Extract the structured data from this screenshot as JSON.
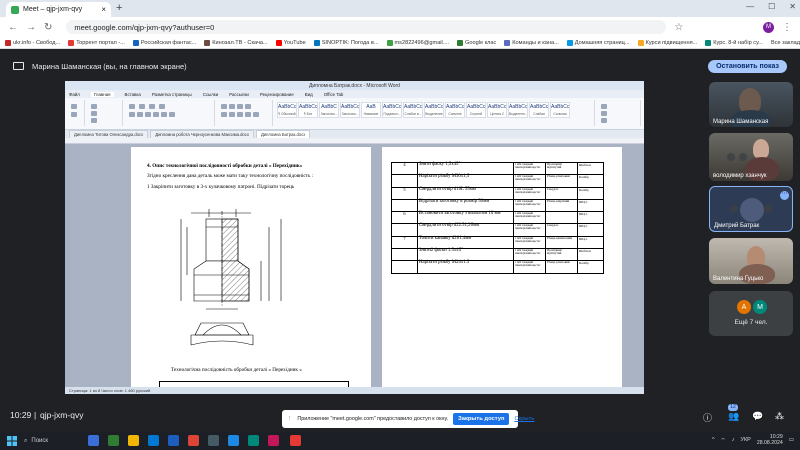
{
  "browser": {
    "tab_title": "Meet – qjp-jxm-qvy",
    "new_tab": "+",
    "url": "meet.google.com/qjp-jxm-qvy?authuser=0",
    "profile_initial": "M",
    "bookmarks": [
      {
        "label": "ukr.info - Свобод...",
        "color": "#c62828"
      },
      {
        "label": "Торрент портал -...",
        "color": "#e53935"
      },
      {
        "label": "Российская фантас...",
        "color": "#1565c0"
      },
      {
        "label": "Кинозал.ТВ - Скача...",
        "color": "#6d4c41"
      },
      {
        "label": "YouTube",
        "color": "#ff0000"
      },
      {
        "label": "SINOPTIK: Погода в...",
        "color": "#0277bd"
      },
      {
        "label": "ms2822496@gmail....",
        "color": "#43a047"
      },
      {
        "label": "Google клас",
        "color": "#2e7d32"
      },
      {
        "label": "Команды и кана...",
        "color": "#5c6bc0"
      },
      {
        "label": "Домашняя страниц...",
        "color": "#039be5"
      },
      {
        "label": "Курси підвищення...",
        "color": "#f9a825"
      },
      {
        "label": "Курс. 8-й набір су...",
        "color": "#00897b"
      }
    ],
    "all_bookmarks": "Все закладки"
  },
  "meet": {
    "presenter_text": "Марина Шаманская (вы, на главном экране)",
    "stop_button": "Остановить показ",
    "time": "10:29",
    "separator": "|",
    "meeting_code": "qjp-jxm-qvy",
    "badge_count": "12",
    "notification_text": "Приложение \"meet.google.com\" предоставило доступ к окну.",
    "notification_close": "Закрыть доступ",
    "notification_hide": "Скрыть",
    "participants": [
      {
        "name": "Марина Шаманская"
      },
      {
        "name": "володимир хзанчук"
      },
      {
        "name": "Дмитрий Батрак"
      },
      {
        "name": "Валентина Гуцько"
      }
    ],
    "more_avatars": [
      "А",
      "М"
    ],
    "more_text": "Ещё 7 чел."
  },
  "word": {
    "window_title": "Дипломна Батрак.docx - Microsoft Word",
    "menu": [
      "Файл",
      "Главная",
      "Вставка",
      "Разметка страницы",
      "Ссылки",
      "Рассылки",
      "Рецензирование",
      "Вид",
      "Office Tab"
    ],
    "styles": [
      {
        "preview": "AaBbCcDt",
        "name": "¶ Обычный"
      },
      {
        "preview": "AaBbCcDt",
        "name": "¶ Без инте..."
      },
      {
        "preview": "AaBbC",
        "name": "Заголово..."
      },
      {
        "preview": "AaBbCc",
        "name": "Заголово..."
      },
      {
        "preview": "AaB",
        "name": "Название"
      },
      {
        "preview": "AaBbCc",
        "name": "Подзагол..."
      },
      {
        "preview": "AaBbCcDt",
        "name": "Слабое в..."
      },
      {
        "preview": "AaBbCcDt",
        "name": "Выделение"
      },
      {
        "preview": "AaBbCcDt",
        "name": "Сильное в..."
      },
      {
        "preview": "AaBbCcDt",
        "name": "Строгий"
      },
      {
        "preview": "AaBbCcDt",
        "name": "Цитата 2"
      },
      {
        "preview": "AaBbCcDt",
        "name": "Выделенн..."
      },
      {
        "preview": "AaBbCcDt",
        "name": "Слабая сс..."
      },
      {
        "preview": "AaBbCcDt",
        "name": "Сильная с..."
      }
    ],
    "doc_tabs": [
      "Дипломна Титова Олександра.docx",
      "Дипломна робота Черноусенкова Максима.docx",
      "Дипломна Батрак.docx"
    ],
    "status": "Страница: 1 из 8   Число слов: 1 460   русский",
    "page1": {
      "heading": "4. Опис технологічної послідовності обробки деталі « Перехідник»",
      "text1": "Згідно креслення дана деталь може мати таку технологічну послідовність :",
      "text2": "1 Закріпити заготовку в 3-х кулачковому патроні. Підрізати торець",
      "caption": "Технологічна послідовність обробки деталі « Перехідник »"
    },
    "operations": [
      {
        "n": "4",
        "op": "Зняти фаску 1,5x45°",
        "machine": "1 к62 токарний гвинторізний верстат",
        "tool": "Прохідний відігнутий",
        "instr": "Шаблон"
      },
      {
        "n": "",
        "op": "Нарізати різьбу М30x1,5",
        "machine": "1 к62 токарний гвинторізний верстат",
        "tool": "Різець різьбовий",
        "instr": "Калібр"
      },
      {
        "n": "5",
        "op": "Свердлити отвір d16L 55мм",
        "machine": "1 к62 токарний гвинторізний верстат",
        "tool": "Свердло",
        "instr": "Калібр"
      },
      {
        "n": "",
        "op": "Відрізати заготовку в розмір 50мм",
        "machine": "1 к62 токарний гвинторізний верстат",
        "tool": "Різець відрізний",
        "instr": "ШЦ-1"
      },
      {
        "n": "6",
        "op": "Встановити заготовку з вильотом 10 мм",
        "machine": "1 к62 токарний гвинторізний верстат",
        "tool": "",
        "instr": "ШЦ-1"
      },
      {
        "n": "",
        "op": "Свердлити отвір d22.51,2бмм",
        "machine": "1 к62 токарний гвинторізний верстат",
        "tool": "Свердло",
        "instr": "ШЦ-1"
      },
      {
        "n": "7",
        "op": "Точити канавку d261.4мм",
        "machine": "1 к62 токарний гвинторізний верстат",
        "tool": "Різець канавочний",
        "instr": "ШЦ-1"
      },
      {
        "n": "",
        "op": "Зняти2 фаски 1.5x45°",
        "machine": "1 к62 токарний гвинторізний верстат",
        "tool": "Прохідний відігнутий",
        "instr": "Шаблон"
      },
      {
        "n": "",
        "op": "Нарізати різьбу М24x1.5",
        "machine": "1 к62 токарний гвинторізний верстат",
        "tool": "Різець різьбовий",
        "instr": "Калібр"
      }
    ]
  },
  "taskbar": {
    "search_label": "Поиск",
    "lang": "УКР",
    "clock_time": "10:29",
    "clock_date": "28.08.2024"
  }
}
